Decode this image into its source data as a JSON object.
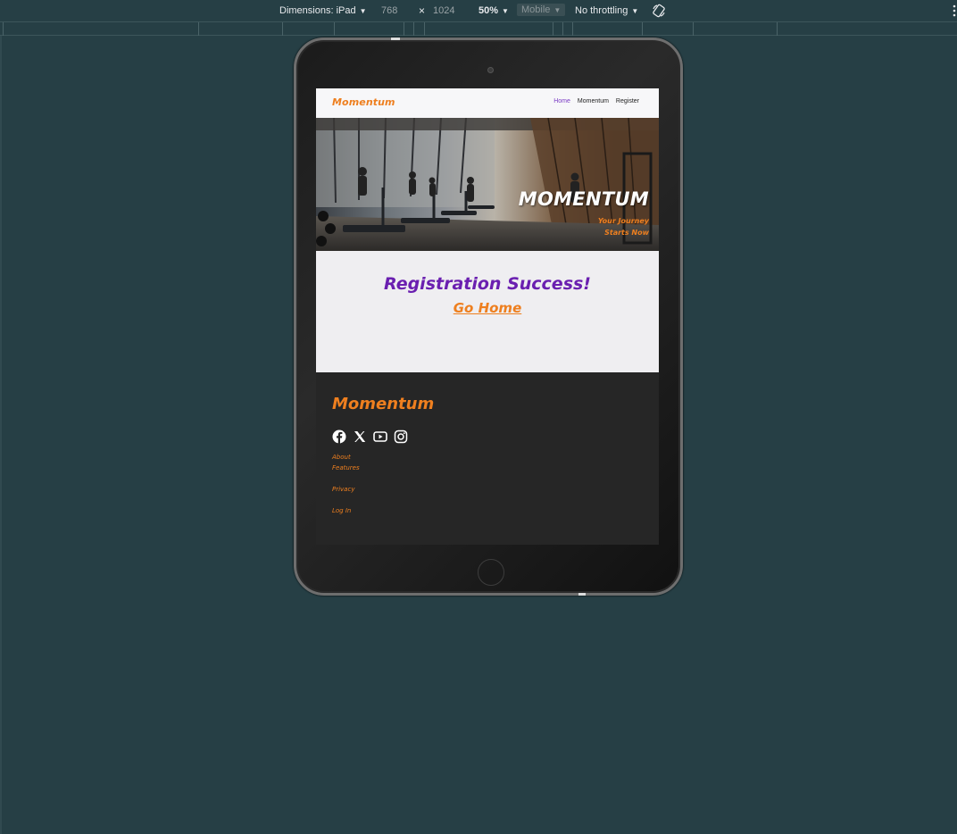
{
  "devtools": {
    "dimensions_label": "Dimensions: iPad",
    "width": "768",
    "times": "×",
    "height": "1024",
    "zoom": "50%",
    "device_type": "Mobile",
    "throttling": "No throttling"
  },
  "site": {
    "brand": "Momentum",
    "nav": [
      {
        "label": "Home",
        "active": true
      },
      {
        "label": "Momentum",
        "active": false
      },
      {
        "label": "Register",
        "active": false
      }
    ],
    "hero": {
      "title": "MOMENTUM",
      "subtitle": "Your Journey Starts Now"
    },
    "main": {
      "heading": "Registration Success!",
      "link": "Go Home"
    },
    "footer": {
      "brand": "Momentum",
      "social_icons": [
        "facebook-icon",
        "x-twitter-icon",
        "youtube-icon",
        "instagram-icon"
      ],
      "links": [
        "About",
        "Features",
        "Privacy",
        "Log In"
      ]
    }
  },
  "colors": {
    "accent_orange": "#ee7f1f",
    "accent_purple": "#6a1fb0",
    "nav_active": "#7b3cc4",
    "footer_bg": "#262626",
    "devtools_bg": "#263f45"
  }
}
